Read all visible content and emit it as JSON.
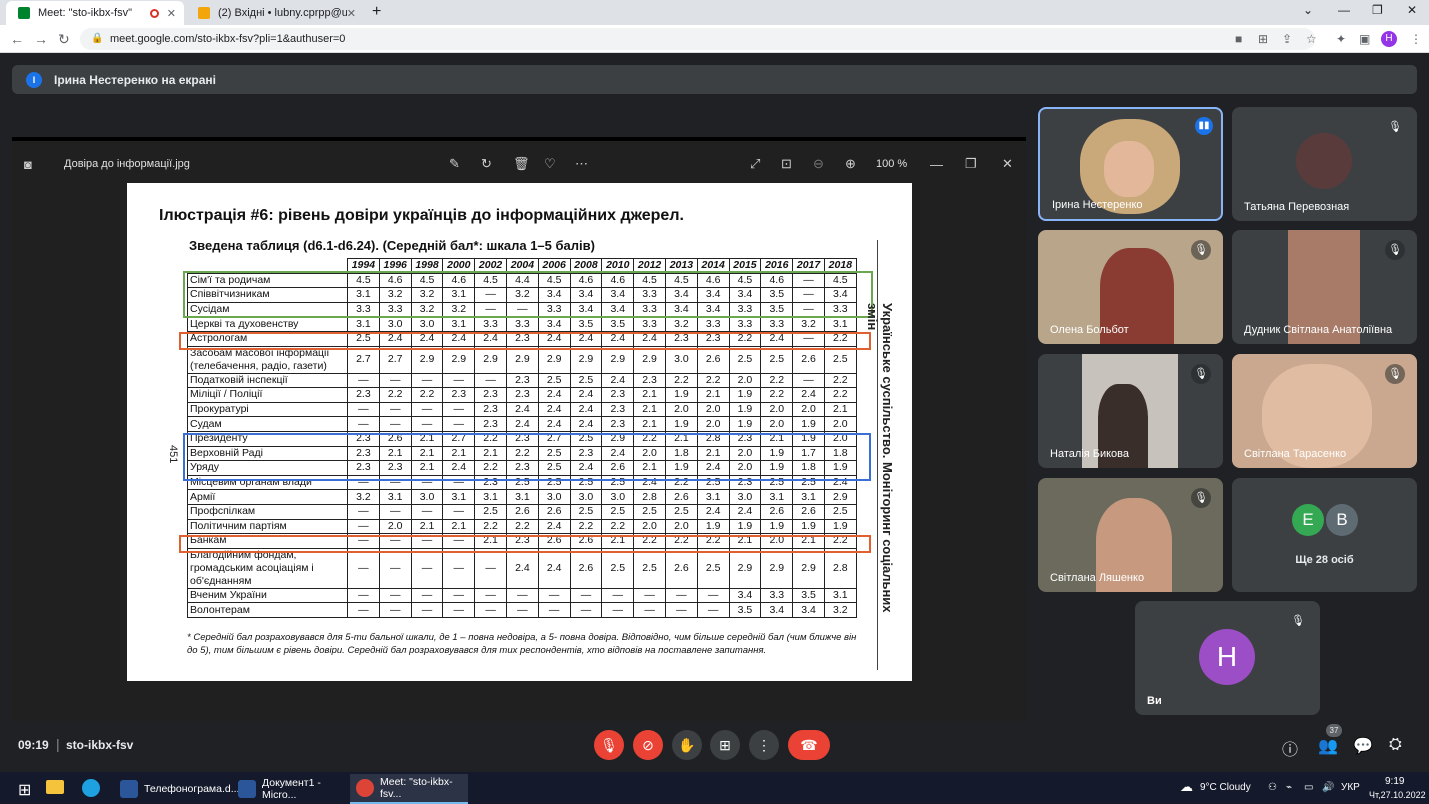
{
  "browser": {
    "tabs": [
      {
        "title": "Meet: \"sto-ikbx-fsv\"",
        "active": true
      },
      {
        "title": "(2) Вхідні • lubny.cprpp@ukr.net",
        "active": false
      }
    ],
    "new_tab": "+",
    "url": "meet.google.com/sto-ikbx-fsv?pli=1&authuser=0",
    "profile_initial": "H"
  },
  "presentation_banner": {
    "initial": "І",
    "text": "Ірина Нестеренко на екрані"
  },
  "viewer": {
    "filename": "Довіра до інформації.jpg",
    "zoom": "100 %"
  },
  "document": {
    "title": "Ілюстрація #6: рівень довіри українців до інформаційних джерел.",
    "subtitle": "Зведена таблиця (d6.1-d6.24). (Середній бал*: шкала 1–5 балів)",
    "years": [
      "1994",
      "1996",
      "1998",
      "2000",
      "2002",
      "2004",
      "2006",
      "2008",
      "2010",
      "2012",
      "2013",
      "2014",
      "2015",
      "2016",
      "2017",
      "2018"
    ],
    "rows": [
      {
        "label": "Сім'ї та родичам",
        "values": [
          "4.5",
          "4.6",
          "4.5",
          "4.6",
          "4.5",
          "4.4",
          "4.5",
          "4.6",
          "4.6",
          "4.5",
          "4.5",
          "4.6",
          "4.5",
          "4.6",
          "—",
          "4.5"
        ]
      },
      {
        "label": "Співвітчизникам",
        "values": [
          "3.1",
          "3.2",
          "3.2",
          "3.1",
          "—",
          "3.2",
          "3.4",
          "3.4",
          "3.4",
          "3.3",
          "3.4",
          "3.4",
          "3.4",
          "3.5",
          "—",
          "3.4"
        ]
      },
      {
        "label": "Сусідам",
        "values": [
          "3.3",
          "3.3",
          "3.2",
          "3.2",
          "—",
          "—",
          "3.3",
          "3.4",
          "3.4",
          "3.3",
          "3.4",
          "3.4",
          "3.3",
          "3.5",
          "—",
          "3.3"
        ]
      },
      {
        "label": "Церкві та духовенству",
        "values": [
          "3.1",
          "3.0",
          "3.0",
          "3.1",
          "3.3",
          "3.3",
          "3.4",
          "3.5",
          "3.5",
          "3.3",
          "3.2",
          "3.3",
          "3.3",
          "3.3",
          "3.2",
          "3.1"
        ]
      },
      {
        "label": "Астрологам",
        "values": [
          "2.5",
          "2.4",
          "2.4",
          "2.4",
          "2.4",
          "2.3",
          "2.4",
          "2.4",
          "2.4",
          "2.4",
          "2.3",
          "2.3",
          "2.2",
          "2.4",
          "—",
          "2.2"
        ]
      },
      {
        "label": "Засобам масової інформації (телебачення, радіо, газети)",
        "values": [
          "2.7",
          "2.7",
          "2.9",
          "2.9",
          "2.9",
          "2.9",
          "2.9",
          "2.9",
          "2.9",
          "2.9",
          "3.0",
          "2.6",
          "2.5",
          "2.5",
          "2.6",
          "2.5"
        ]
      },
      {
        "label": "Податковій інспекції",
        "values": [
          "—",
          "—",
          "—",
          "—",
          "—",
          "2.3",
          "2.5",
          "2.5",
          "2.4",
          "2.3",
          "2.2",
          "2.2",
          "2.0",
          "2.2",
          "—",
          "2.2"
        ]
      },
      {
        "label": "Міліції / Поліції",
        "values": [
          "2.3",
          "2.2",
          "2.2",
          "2.3",
          "2.3",
          "2.3",
          "2.4",
          "2.4",
          "2.3",
          "2.1",
          "1.9",
          "2.1",
          "1.9",
          "2.2",
          "2.4",
          "2.2"
        ]
      },
      {
        "label": "Прокуратурі",
        "values": [
          "—",
          "—",
          "—",
          "—",
          "2.3",
          "2.4",
          "2.4",
          "2.4",
          "2.3",
          "2.1",
          "2.0",
          "2.0",
          "1.9",
          "2.0",
          "2.0",
          "2.1"
        ]
      },
      {
        "label": "Судам",
        "values": [
          "—",
          "—",
          "—",
          "—",
          "2.3",
          "2.4",
          "2.4",
          "2.4",
          "2.3",
          "2.1",
          "1.9",
          "2.0",
          "1.9",
          "2.0",
          "1.9",
          "2.0"
        ]
      },
      {
        "label": "Президенту",
        "values": [
          "2.3",
          "2.6",
          "2.1",
          "2.7",
          "2.2",
          "2.3",
          "2.7",
          "2.5",
          "2.9",
          "2.2",
          "2.1",
          "2.8",
          "2.3",
          "2.1",
          "1.9",
          "2.0"
        ]
      },
      {
        "label": "Верховній Раді",
        "values": [
          "2.3",
          "2.1",
          "2.1",
          "2.1",
          "2.1",
          "2.2",
          "2.5",
          "2.3",
          "2.4",
          "2.0",
          "1.8",
          "2.1",
          "2.0",
          "1.9",
          "1.7",
          "1.8"
        ]
      },
      {
        "label": "Уряду",
        "values": [
          "2.3",
          "2.3",
          "2.1",
          "2.4",
          "2.2",
          "2.3",
          "2.5",
          "2.4",
          "2.6",
          "2.1",
          "1.9",
          "2.4",
          "2.0",
          "1.9",
          "1.8",
          "1.9"
        ]
      },
      {
        "label": "Місцевим органам влади",
        "values": [
          "—",
          "—",
          "—",
          "—",
          "2.3",
          "2.5",
          "2.5",
          "2.5",
          "2.5",
          "2.4",
          "2.2",
          "2.5",
          "2.3",
          "2.5",
          "2.5",
          "2.4"
        ]
      },
      {
        "label": "Армії",
        "values": [
          "3.2",
          "3.1",
          "3.0",
          "3.1",
          "3.1",
          "3.1",
          "3.0",
          "3.0",
          "3.0",
          "2.8",
          "2.6",
          "3.1",
          "3.0",
          "3.1",
          "3.1",
          "2.9"
        ]
      },
      {
        "label": "Профспілкам",
        "values": [
          "—",
          "—",
          "—",
          "—",
          "2.5",
          "2.6",
          "2.6",
          "2.5",
          "2.5",
          "2.5",
          "2.5",
          "2.4",
          "2.4",
          "2.6",
          "2.6",
          "2.5"
        ]
      },
      {
        "label": "Політичним партіям",
        "values": [
          "—",
          "2.0",
          "2.1",
          "2.1",
          "2.2",
          "2.2",
          "2.4",
          "2.2",
          "2.2",
          "2.0",
          "2.0",
          "1.9",
          "1.9",
          "1.9",
          "1.9",
          "1.9"
        ]
      },
      {
        "label": "Банкам",
        "values": [
          "—",
          "—",
          "—",
          "—",
          "2.1",
          "2.3",
          "2.6",
          "2.6",
          "2.1",
          "2.2",
          "2.2",
          "2.2",
          "2.1",
          "2.0",
          "2.1",
          "2.2"
        ]
      },
      {
        "label": "Благодійним фондам, громадським асоціаціям і об'єднанням",
        "values": [
          "—",
          "—",
          "—",
          "—",
          "—",
          "2.4",
          "2.4",
          "2.6",
          "2.5",
          "2.5",
          "2.6",
          "2.5",
          "2.9",
          "2.9",
          "2.9",
          "2.8"
        ]
      },
      {
        "label": "Вченим України",
        "values": [
          "—",
          "—",
          "—",
          "—",
          "—",
          "—",
          "—",
          "—",
          "—",
          "—",
          "—",
          "—",
          "3.4",
          "3.3",
          "3.5",
          "3.1"
        ]
      },
      {
        "label": "Волонтерам",
        "values": [
          "—",
          "—",
          "—",
          "—",
          "—",
          "—",
          "—",
          "—",
          "—",
          "—",
          "—",
          "—",
          "3.5",
          "3.4",
          "3.4",
          "3.2"
        ]
      }
    ],
    "side_text": "Українське суспільство. Моніторинг соціальних змін",
    "page_number": "451",
    "footnote": "* Середній бал розраховувався для 5-ти бальної шкали, де 1 – повна недовіра, а 5- повна довіра. Відповідно, чим більше середній бал (чим ближче він до 5), тим більшим є рівень довіри. Середній бал розраховувався для тих респондентів, хто відповів на поставлене запитання.",
    "box_colors": {
      "green": "#6aa84f",
      "orange": "#e06030",
      "blue": "#3a6fd8"
    }
  },
  "participants": [
    {
      "name": "Ірина Нестеренко",
      "speaking": true
    },
    {
      "name": "Татьяна Перевозная",
      "muted": true
    },
    {
      "name": "Олена Больбот",
      "muted": true
    },
    {
      "name": "Дудник Світлана Анатоліївна",
      "muted": true
    },
    {
      "name": "Наталія Бикова",
      "muted": true
    },
    {
      "name": "Світлана Тарасенко",
      "muted": true
    },
    {
      "name": "Світлана Ляшенко",
      "muted": true
    }
  ],
  "others": {
    "initial1": "E",
    "initial2": "B",
    "label": "Ще 28 осіб"
  },
  "self": {
    "initial": "H",
    "name": "Ви"
  },
  "meeting": {
    "time": "09:19",
    "code": "sto-ikbx-fsv",
    "participants_count": "37"
  },
  "taskbar": {
    "items": [
      "Телефонограма.d...",
      "Документ1 - Micro...",
      "Meet: \"sto-ikbx-fsv..."
    ],
    "weather": "9°C  Cloudy",
    "lang": "УКР",
    "clock_time": "9:19",
    "clock_date": "Чт,27.10.2022"
  }
}
